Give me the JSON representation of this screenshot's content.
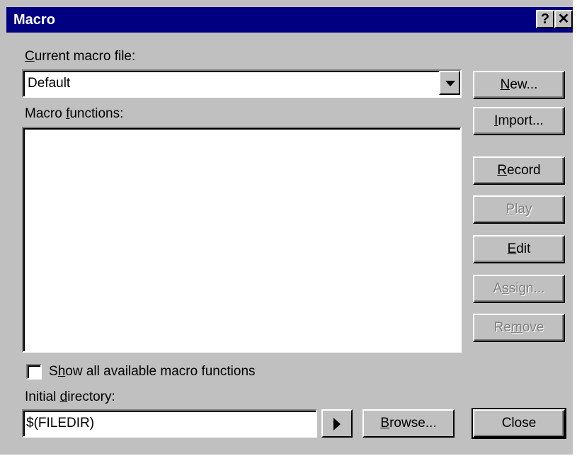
{
  "window": {
    "title": "Macro",
    "help_glyph": "?",
    "close_glyph": "✕"
  },
  "current_file": {
    "label_prefix": "",
    "label_mnemonic": "C",
    "label_rest": "urrent macro file:",
    "value": "Default"
  },
  "functions": {
    "label_prefix": "Macro ",
    "label_mnemonic": "f",
    "label_rest": "unctions:",
    "items": []
  },
  "buttons": {
    "new": {
      "pre": "",
      "mn": "N",
      "post": "ew...",
      "enabled": true
    },
    "import": {
      "pre": "",
      "mn": "I",
      "post": "mport...",
      "enabled": true
    },
    "record": {
      "pre": "",
      "mn": "R",
      "post": "ecord",
      "enabled": true
    },
    "play": {
      "pre": "",
      "mn": "P",
      "post": "lay",
      "enabled": false
    },
    "edit": {
      "pre": "",
      "mn": "E",
      "post": "dit",
      "enabled": true
    },
    "assign": {
      "pre": "A",
      "mn": "s",
      "post": "sign...",
      "enabled": false
    },
    "remove": {
      "pre": "Re",
      "mn": "m",
      "post": "ove",
      "enabled": false
    },
    "close": {
      "label": "Close"
    },
    "browse": {
      "pre": "",
      "mn": "B",
      "post": "rowse..."
    }
  },
  "show_all": {
    "pre": "S",
    "mn": "h",
    "post": "ow all available macro functions",
    "checked": false
  },
  "initial_dir": {
    "label_prefix": "Initial ",
    "label_mnemonic": "d",
    "label_rest": "irectory:",
    "value": "$(FILEDIR)"
  },
  "colors": {
    "face": "#c0c0c0",
    "titlebar": "#000080",
    "disabled_text": "#808080"
  }
}
